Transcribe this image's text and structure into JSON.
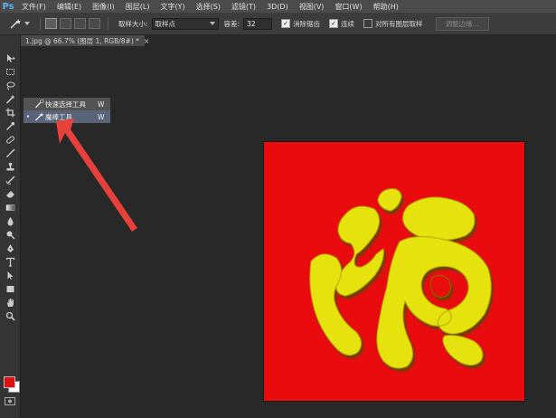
{
  "app": {
    "logo": "Ps"
  },
  "menu": [
    "文件(F)",
    "编辑(E)",
    "图像(I)",
    "图层(L)",
    "文字(Y)",
    "选择(S)",
    "滤镜(T)",
    "3D(D)",
    "视图(V)",
    "窗口(W)",
    "帮助(H)"
  ],
  "options": {
    "sample_size_label": "取样大小:",
    "sample_size_value": "取样点",
    "tolerance_label": "容差:",
    "tolerance_value": "32",
    "antialias_label": "消除锯齿",
    "contiguous_label": "连续",
    "sample_all_label": "对所有图层取样",
    "refine_edge_label": "调整边缘..."
  },
  "document": {
    "tab_title": "1.jpg @ 66.7% (图层 1, RGB/8#) *",
    "tab_close": "×"
  },
  "flyout": {
    "items": [
      {
        "label": "快速选择工具",
        "shortcut": "W",
        "selected": false
      },
      {
        "label": "魔棒工具",
        "shortcut": "W",
        "selected": true
      }
    ],
    "bullet": "•"
  },
  "colors": {
    "foreground": "#e01010",
    "background": "#ffffff",
    "canvas_red": "#ea0b0f",
    "glyph_yellow": "#e6e20c",
    "arrow": "#e8403a"
  },
  "icons": [
    "move-icon",
    "marquee-icon",
    "lasso-icon",
    "magic-wand-icon",
    "crop-icon",
    "eyedropper-icon",
    "healing-brush-icon",
    "brush-icon",
    "clone-stamp-icon",
    "history-brush-icon",
    "eraser-icon",
    "gradient-icon",
    "blur-icon",
    "dodge-icon",
    "pen-icon",
    "type-icon",
    "path-selection-icon",
    "rectangle-shape-icon",
    "hand-icon",
    "zoom-icon"
  ]
}
